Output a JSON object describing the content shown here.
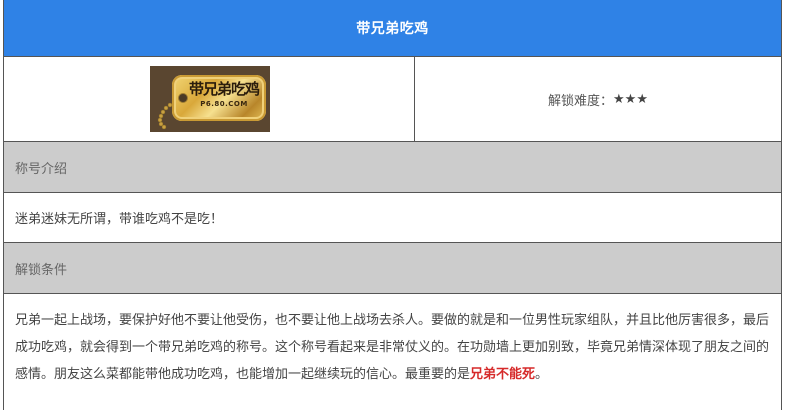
{
  "header": {
    "title": "带兄弟吃鸡"
  },
  "badge": {
    "tag_text": "带兄弟吃鸡",
    "tag_subtext": "P6.80.COM",
    "difficulty_label": "解锁难度：",
    "difficulty_stars": "★★★",
    "colors": {
      "header_bg": "#2f82e6",
      "section_bg": "#cccccc",
      "highlight": "#d62a2a"
    }
  },
  "intro": {
    "heading": "称号介绍",
    "text": "迷弟迷妹无所谓，带谁吃鸡不是吃！"
  },
  "conditions": {
    "heading": "解锁条件",
    "text": "兄弟一起上战场，要保护好他不要让他受伤，也不要让他上战场去杀人。要做的就是和一位男性玩家组队，并且比他厉害很多，最后成功吃鸡，就会得到一个带兄弟吃鸡的称号。这个称号看起来是非常仗义的。在功勋墙上更加别致，毕竟兄弟情深体现了朋友之间的感情。朋友这么菜都能带他成功吃鸡，也能增加一起继续玩的信心。最重要的是",
    "highlight": "兄弟不能死",
    "end": "。"
  }
}
